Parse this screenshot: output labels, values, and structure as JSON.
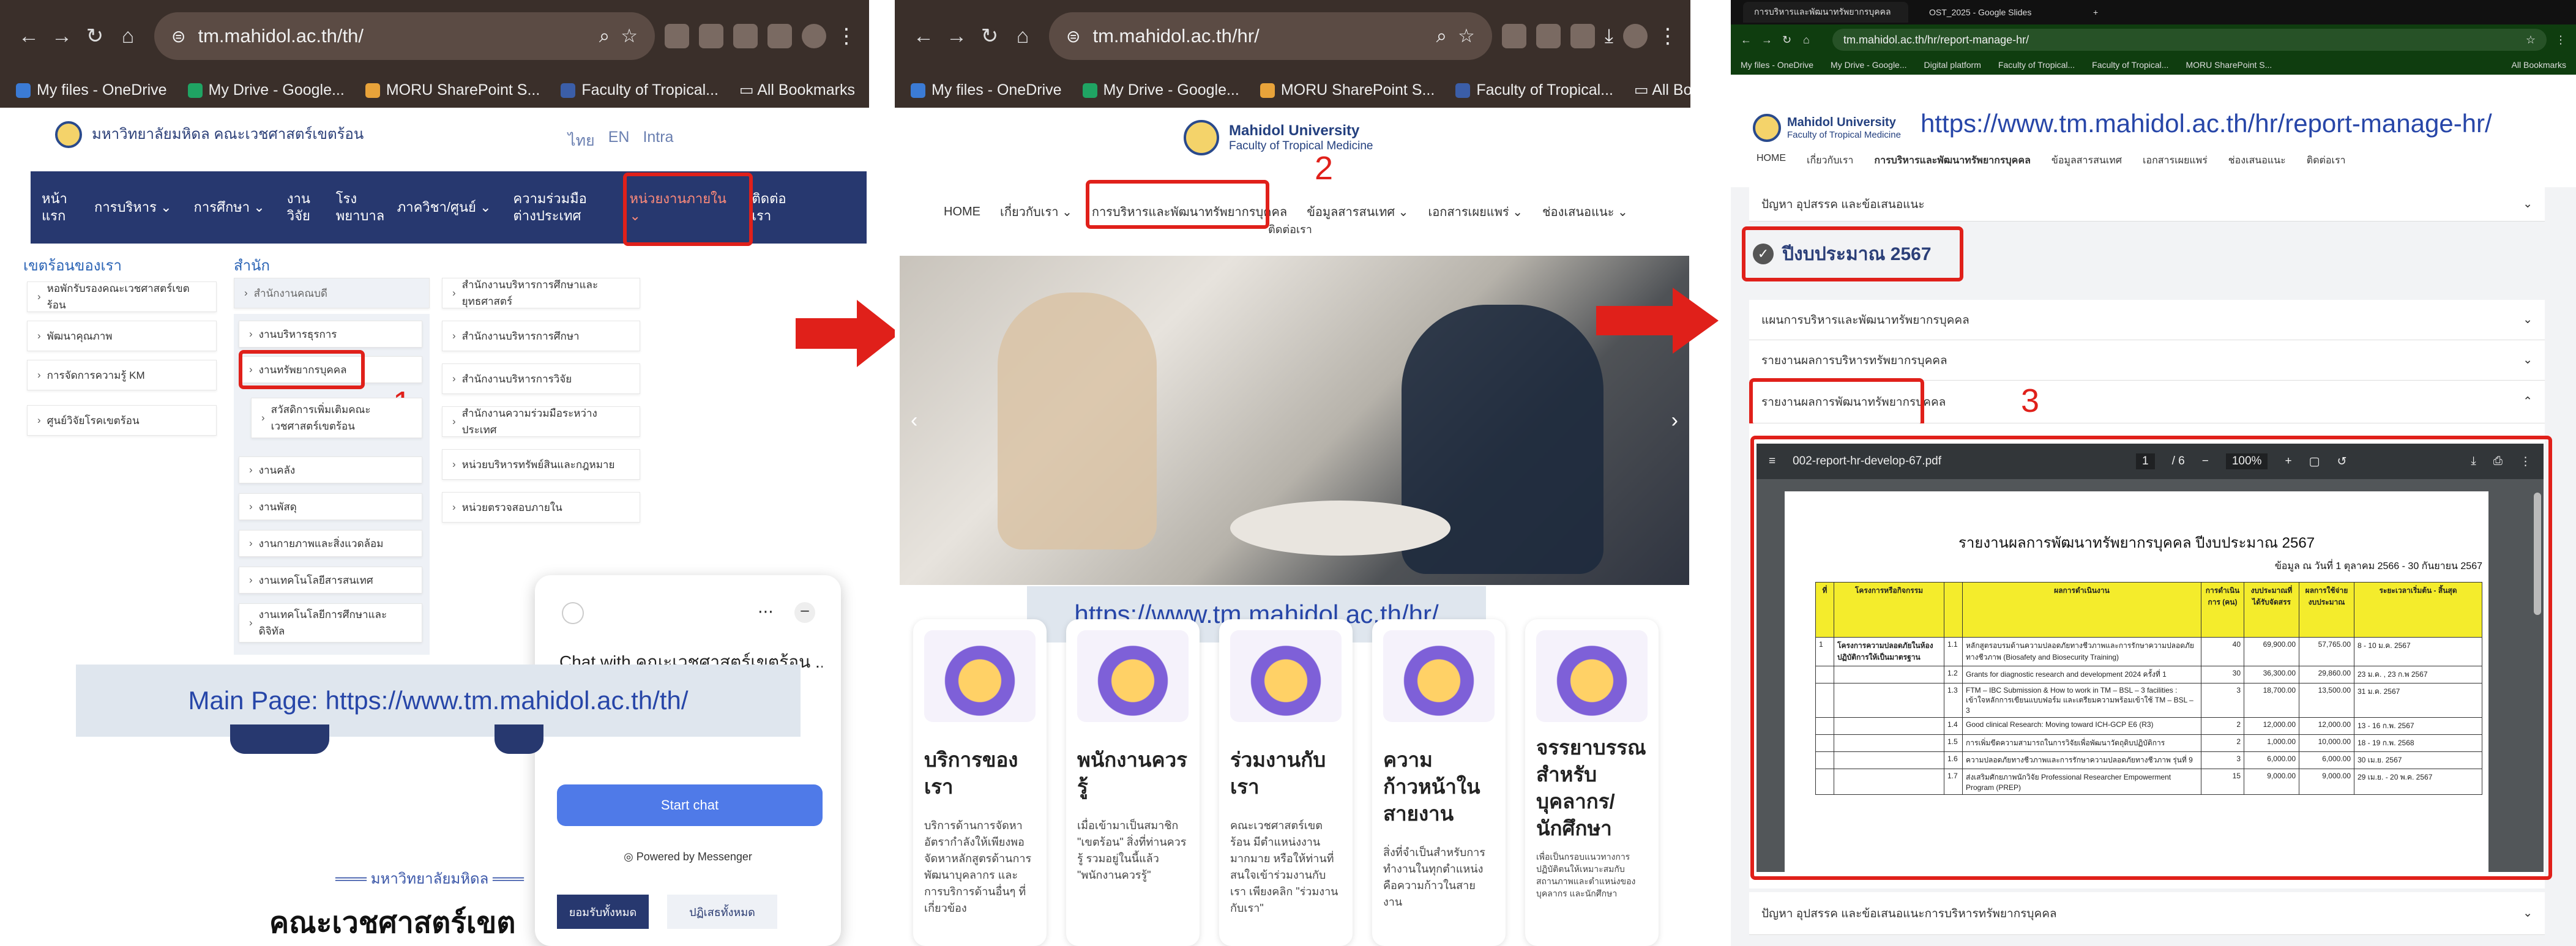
{
  "screen1": {
    "url": "tm.mahidol.ac.th/th/",
    "bookmarks": [
      "My files - OneDrive",
      "My Drive - Google...",
      "MORU SharePoint S...",
      "Faculty of Tropical...",
      "All Bookmarks"
    ],
    "logo_text": "มหาวิทยาลัยมหิดล คณะเวชศาสตร์เขตร้อน",
    "lang": [
      "ไทย",
      "EN",
      "Intra"
    ],
    "nav": [
      "หน้าแรก",
      "การบริหาร",
      "การศึกษา",
      "งานวิจัย",
      "โรงพยาบาล",
      "ภาควิชา/ศูนย์",
      "ความร่วมมือต่างประเทศ",
      "หน่วยงานภายใน",
      "ติดต่อเรา"
    ],
    "col1_head": "เขตร้อนของเรา",
    "col1": [
      "หอพักรับรองคณะเวชศาสตร์เขตร้อน",
      "พัฒนาคุณภาพ",
      "การจัดการความรู้ KM",
      "ศูนย์วิจัยโรคเขตร้อน"
    ],
    "col2_head": "สำนัก",
    "col2_sub": "สำนักงานคณบดี",
    "col2": [
      "งานบริหารธุรการ",
      "งานทรัพยากรบุคคล",
      "สวัสดิการเพิ่มเติมคณะเวชศาสตร์เขตร้อน",
      "งานคลัง",
      "งานพัสดุ",
      "งานกายภาพและสิ่งแวดล้อม",
      "งานเทคโนโลยีสารสนเทศ",
      "งานเทคโนโลยีการศึกษาและดิจิทัล"
    ],
    "col3": [
      "สำนักงานบริหารการศึกษาและยุทธศาสตร์",
      "สำนักงานบริหารการศึกษา",
      "สำนักงานบริหารการวิจัย",
      "สำนักงานความร่วมมือระหว่างประเทศ",
      "หน่วยบริหารทรัพย์สินและกฎหมาย",
      "หน่วยตรวจสอบภายใน"
    ],
    "step": "1",
    "chat_title": "Chat with คณะเวชศาสตร์เขตร้อน ...",
    "chat_button": "Start chat",
    "chat_powered": "Powered by Messenger",
    "label": "Main Page: https://www.tm.mahidol.ac.th/th/",
    "bottom_tag": "มหาวิทยาลัยมหิดล",
    "bottom_title": "คณะเวชศาสตร์เขต",
    "cookie_accept": "ยอมรับทั้งหมด",
    "cookie_reject": "ปฏิเสธทั้งหมด"
  },
  "screen2": {
    "url": "tm.mahidol.ac.th/hr/",
    "bookmarks": [
      "My files - OneDrive",
      "My Drive - Google...",
      "MORU SharePoint S...",
      "Faculty of Tropical...",
      "All Bookmarks"
    ],
    "logo_title": "Mahidol University",
    "logo_sub": "Faculty of Tropical Medicine",
    "nav": [
      "HOME",
      "เกี่ยวกับเรา",
      "การบริหารและพัฒนาทรัพยากรบุคคล",
      "ข้อมูลสารสนเทศ",
      "เอกสารเผยแพร่",
      "ช่องเสนอแนะ",
      "ติดต่อเรา"
    ],
    "step": "2",
    "label": "https://www.tm.mahidol.ac.th/hr/",
    "cards": [
      {
        "title": "บริการของเรา",
        "body": "บริการด้านการจัดหาอัตรากำลังให้เพียงพอ จัดหาหลักสูตรด้านการพัฒนาบุคลากร และการบริการด้านอื่นๆ ที่เกี่ยวข้อง"
      },
      {
        "title": "พนักงานควรรู้",
        "body": "เมื่อเข้ามาเป็นสมาชิก \"เขตร้อน\" สิ่งที่ท่านควรรู้ รวมอยู่ในนี้แล้ว \"พนักงานควรรู้\""
      },
      {
        "title": "ร่วมงานกับเรา",
        "body": "คณะเวชศาสตร์เขตร้อน มีตำแหน่งงานมากมาย หรือให้ท่านที่สนใจเข้าร่วมงานกับเรา เพียงคลิก \"ร่วมงานกับเรา\""
      },
      {
        "title": "ความก้าวหน้าในสายงาน",
        "body": "สิ่งที่จำเป็นสำหรับการทำงานในทุกตำแหน่ง คือความก้าวในสายงาน"
      },
      {
        "title": "จรรยาบรรณสำหรับบุคลากร/นักศึกษา",
        "body": "เพื่อเป็นกรอบแนวทางการปฏิบัติตนให้เหมาะสมกับสถานภาพและตำแหน่งของบุคลากร และนักศึกษา"
      }
    ]
  },
  "screen3": {
    "tabs": [
      "การบริหารและพัฒนาทรัพยากรบุคคล",
      "OST_2025 - Google Slides"
    ],
    "url": "tm.mahidol.ac.th/hr/report-manage-hr/",
    "bookmarks": [
      "My files - OneDrive",
      "My Drive - Google...",
      "Digital platform",
      "Faculty of Tropical...",
      "Faculty of Tropical...",
      "MORU SharePoint S...",
      "All Bookmarks"
    ],
    "logo_title": "Mahidol University",
    "logo_sub": "Faculty of Tropical Medicine",
    "label": "https://www.tm.mahidol.ac.th/hr/report-manage-hr/",
    "nav": [
      "HOME",
      "เกี่ยวกับเรา",
      "การบริหารและพัฒนาทรัพยากรบุคคล",
      "ข้อมูลสารสนเทศ",
      "เอกสารเผยแพร่",
      "ช่องเสนอแนะ",
      "ติดต่อเรา"
    ],
    "acc_top": "ปัญหา อุปสรรค และข้อเสนอแนะ",
    "year": "ปีงบประมาณ 2567",
    "acc": [
      "แผนการบริหารและพัฒนาทรัพยากรบุคคล",
      "รายงานผลการบริหารทรัพยากรบุคคล",
      "รายงานผลการพัฒนาทรัพยากรบุคคล"
    ],
    "step": "3",
    "pdf_name": "002-report-hr-develop-67.pdf",
    "pdf_page": "1",
    "pdf_pages": "/ 6",
    "pdf_zoom": "100%",
    "pdf_title": "รายงานผลการพัฒนาทรัพยากรบุคคล ปีงบประมาณ 2567",
    "pdf_sub": "ข้อมูล ณ วันที่ 1 ตุลาคม 2566 - 30 กันยายน 2567",
    "pdf_headers": [
      "ที่",
      "โครงการหรือกิจกรรม",
      "ผลการดำเนินงาน",
      "",
      "การดำเนินการ (คน)",
      "งบประมาณที่ได้รับจัดสรร",
      "ผลการใช้จ่ายงบประมาณ",
      "ระยะเวลาเริ่มต้น - สิ้นสุด"
    ],
    "pdf_rows": [
      {
        "n": "1",
        "proj": "โครงการความปลอดภัยในห้องปฏิบัติการให้เป็นมาตรฐาน",
        "i": "1.1",
        "res": "หลักสูตรอบรมด้านความปลอดภัยทางชีวภาพและการรักษาความปลอดภัยทางชีวภาพ (Biosafety and Biosecurity Training)",
        "c": "40",
        "b": "69,900.00",
        "s": "57,765.00",
        "t": "8 - 10 ม.ค. 2567"
      },
      {
        "n": "",
        "proj": "",
        "i": "1.2",
        "res": "Grants for diagnostic research and development 2024 ครั้งที่ 1",
        "c": "30",
        "b": "36,300.00",
        "s": "29,860.00",
        "t": "23 ม.ค. , 23 ก.พ 2567"
      },
      {
        "n": "",
        "proj": "",
        "i": "1.3",
        "res": "FTM – IBC Submission & How to work in TM – BSL – 3 facilities : เข้าใจหลักการเขียนแบบฟอร์ม และเตรียมความพร้อมเข้าใช้ TM – BSL – 3",
        "c": "3",
        "b": "18,700.00",
        "s": "13,500.00",
        "t": "31 ม.ค. 2567"
      },
      {
        "n": "",
        "proj": "",
        "i": "1.4",
        "res": "Good clinical Research: Moving toward ICH-GCP E6 (R3)",
        "c": "2",
        "b": "12,000.00",
        "s": "12,000.00",
        "t": "13 - 16 ก.พ. 2567"
      },
      {
        "n": "",
        "proj": "",
        "i": "1.5",
        "res": "การเพิ่มขีดความสามารถในการวิจัยเพื่อพัฒนาวัตถุดิบปฏิบัติการ",
        "c": "2",
        "b": "1,000.00",
        "s": "10,000.00",
        "t": "18 - 19 ก.พ. 2568"
      },
      {
        "n": "",
        "proj": "",
        "i": "1.6",
        "res": "ความปลอดภัยทางชีวภาพและการรักษาความปลอดภัยทางชีวภาพ รุ่นที่ 9",
        "c": "3",
        "b": "6,000.00",
        "s": "6,000.00",
        "t": "30 เม.ย. 2567"
      },
      {
        "n": "",
        "proj": "",
        "i": "1.7",
        "res": "ส่งเสริมศักยภาพนักวิจัย Professional Researcher Empowerment Program (PREP)",
        "c": "15",
        "b": "9,000.00",
        "s": "9,000.00",
        "t": "29 เม.ย. - 20 พ.ค. 2567"
      }
    ],
    "acc_bottom": "ปัญหา อุปสรรค และข้อเสนอแนะการบริหารทรัพยากรบุคคล"
  },
  "colors": {
    "accent_red": "#e0201a",
    "nav_blue": "#27386f",
    "link_blue": "#2746a8",
    "chat_blue": "#4f7ae8",
    "table_yellow": "#f4ec2c"
  },
  "icons": [
    "back-icon",
    "forward-icon",
    "reload-icon",
    "home-icon",
    "site-info-icon",
    "zoom-icon",
    "star-icon",
    "extension-icon",
    "profile-icon",
    "menu-icon",
    "folder-icon",
    "chevron-down-icon",
    "check-circle-icon",
    "arrow-right-icon",
    "chat-icon",
    "print-icon",
    "download-icon"
  ]
}
